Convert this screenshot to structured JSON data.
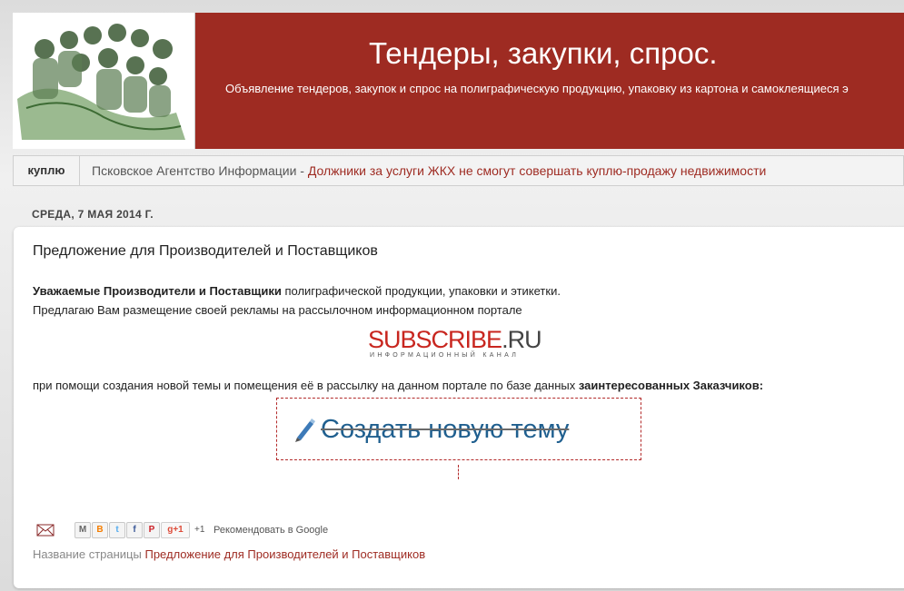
{
  "header": {
    "title": "Тендеры, закупки, спрос.",
    "description": "Объявление тендеров, закупок и спрос на полиграфическую продукцию, упаковку из картона и самоклеящиеся э"
  },
  "navbar": {
    "tab_label": "куплю",
    "ticker_source": "Псковское Агентство Информации - ",
    "ticker_link": "Должники за услуги ЖКХ не смогут совершать куплю-продажу недвижимости"
  },
  "post": {
    "date": "СРЕДА, 7 МАЯ 2014 Г.",
    "title": "Предложение для Производителей и Поставщиков",
    "intro_bold": "Уважаемые Производители и Поставщики",
    "intro_rest": " полиграфической продукции, упаковки и этикетки.",
    "offer": "Предлагаю Вам размещение своей рекламы на рассылочном информационном портале",
    "logo": {
      "part1": "SUB",
      "part2": "S",
      "part3": "CRIBE",
      "part4": ".RU",
      "caption": "ИНФОРМАЦИОННЫЙ КАНАЛ"
    },
    "method_text": "при помощи создания новой темы и помещения её в рассылку на данном портале по базе данных ",
    "method_bold": "заинтересованных Заказчиков:",
    "create_topic_label": "Создать новую тему"
  },
  "share": {
    "buttons": [
      "M",
      "B",
      "t",
      "f",
      "P"
    ],
    "gplus_label": "g+1",
    "plus_count": "+1",
    "recommend": "Рекомендовать в Google"
  },
  "footer": {
    "page_name_label": "Название страницы ",
    "page_name_link": "Предложение для Производителей и Поставщиков"
  },
  "colors": {
    "header_bg": "#9e2b22",
    "link": "#9e2b22",
    "logo_red": "#c8261f",
    "create_topic_blue": "#1f5f8f"
  }
}
